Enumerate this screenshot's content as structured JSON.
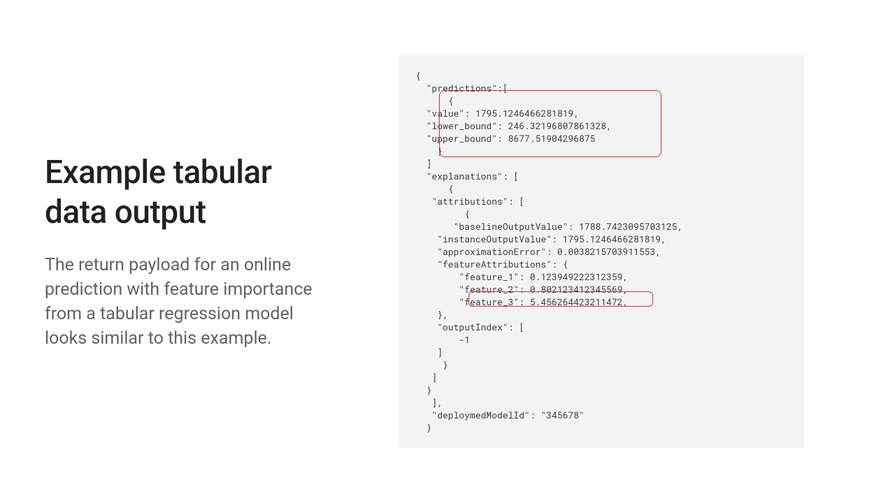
{
  "left": {
    "heading": "Example tabular data output",
    "body": "The return payload for an online prediction with feature importance from a tabular regression model looks similar to this example."
  },
  "code": {
    "lines": [
      "{",
      "  \"predictions\":[",
      "      {",
      "  \"value\": 1795.1246466281819,",
      "  \"lower_bound\": 246.32196807861328,",
      "  \"upper_bound\": 8677.51904296875",
      "    }",
      "  ]",
      "  \"explanations\": [",
      "      {",
      "   \"attributions\": [",
      "         {",
      "       \"baselineOutputValue\": 1788.7423095703125,",
      "    \"instanceOutputValue\": 1795.1246466281819,",
      "    \"approximationError\": 0.0038215703911553,",
      "    \"featureAttributions\": {",
      "        \"feature_1\": 0.123949222312359,",
      "        \"feature_2\": 0.802123412345569,",
      "        \"feature_3\": 5.456264423211472,",
      "    },",
      "    \"outputIndex\": [",
      "        -1",
      "    ]",
      "     }",
      "   ]",
      "  }",
      "   ],",
      "   \"deploymedModelId\": \"345678\"",
      "  }"
    ]
  }
}
